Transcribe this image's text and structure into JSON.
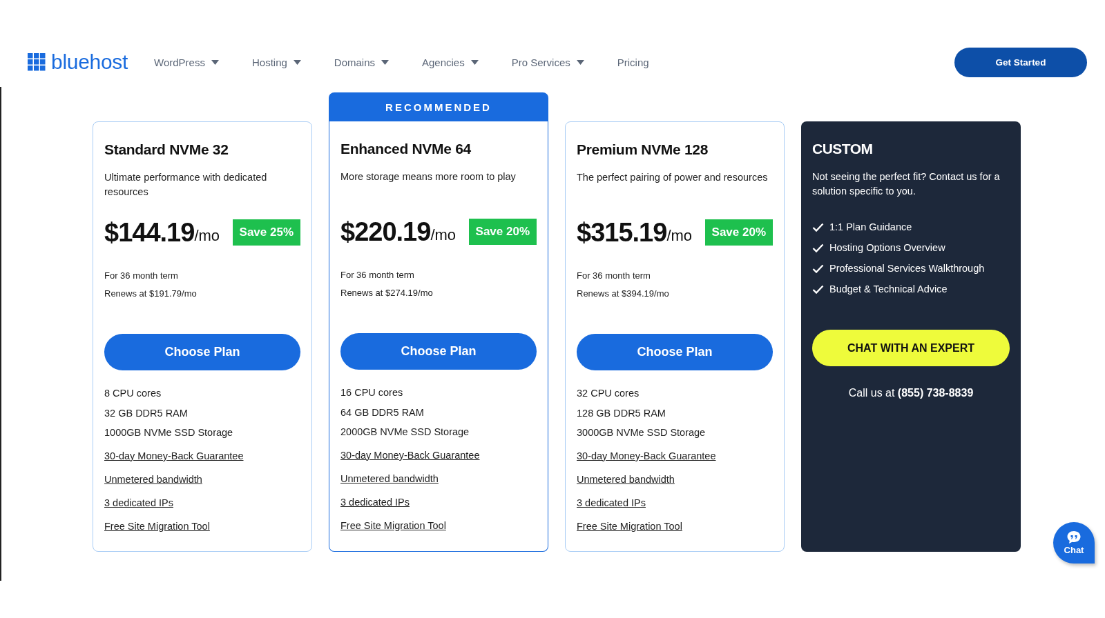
{
  "header": {
    "logo": "bluehost",
    "menu": [
      {
        "label": "WordPress",
        "dropdown": true
      },
      {
        "label": "Hosting",
        "dropdown": true
      },
      {
        "label": "Domains",
        "dropdown": true
      },
      {
        "label": "Agencies",
        "dropdown": true
      },
      {
        "label": "Pro Services",
        "dropdown": true
      },
      {
        "label": "Pricing",
        "dropdown": false
      }
    ],
    "cta": "Get Started"
  },
  "plans": [
    {
      "recommended": false,
      "name": "Standard NVMe 32",
      "description": "Ultimate performance with dedicated resources",
      "price": "$144.19",
      "unit": "/mo",
      "save": "Save 25%",
      "term": "For 36 month term",
      "renews": "Renews at $191.79/mo",
      "button": "Choose Plan",
      "specs": [
        "8 CPU cores",
        "32 GB DDR5 RAM",
        "1000GB NVMe SSD Storage"
      ],
      "links": [
        "30-day Money-Back Guarantee",
        "Unmetered bandwidth",
        "3 dedicated IPs",
        "Free Site Migration Tool"
      ]
    },
    {
      "recommended": true,
      "badge": "RECOMMENDED",
      "name": "Enhanced NVMe 64",
      "description": "More storage means more room to play",
      "price": "$220.19",
      "unit": "/mo",
      "save": "Save 20%",
      "term": "For 36 month term",
      "renews": "Renews at $274.19/mo",
      "button": "Choose Plan",
      "specs": [
        "16 CPU cores",
        "64 GB DDR5 RAM",
        "2000GB NVMe SSD Storage"
      ],
      "links": [
        "30-day Money-Back Guarantee",
        "Unmetered bandwidth",
        "3 dedicated IPs",
        "Free Site Migration Tool"
      ]
    },
    {
      "recommended": false,
      "name": "Premium NVMe 128",
      "description": "The perfect pairing of power and resources",
      "price": "$315.19",
      "unit": "/mo",
      "save": "Save 20%",
      "term": "For 36 month term",
      "renews": "Renews at $394.19/mo",
      "button": "Choose Plan",
      "specs": [
        "32 CPU cores",
        "128 GB DDR5 RAM",
        "3000GB NVMe SSD Storage"
      ],
      "links": [
        "30-day Money-Back Guarantee",
        "Unmetered bandwidth",
        "3 dedicated IPs",
        "Free Site Migration Tool"
      ]
    }
  ],
  "custom": {
    "title": "CUSTOM",
    "description": "Not seeing the perfect fit? Contact us for a solution specific to you.",
    "features": [
      "1:1 Plan Guidance",
      "Hosting Options Overview",
      "Professional Services Walkthrough",
      "Budget & Technical Advice"
    ],
    "button": "CHAT WITH AN EXPERT",
    "phone": "Call us at **(855) 738-8839**"
  },
  "chat": {
    "label": "Chat"
  }
}
